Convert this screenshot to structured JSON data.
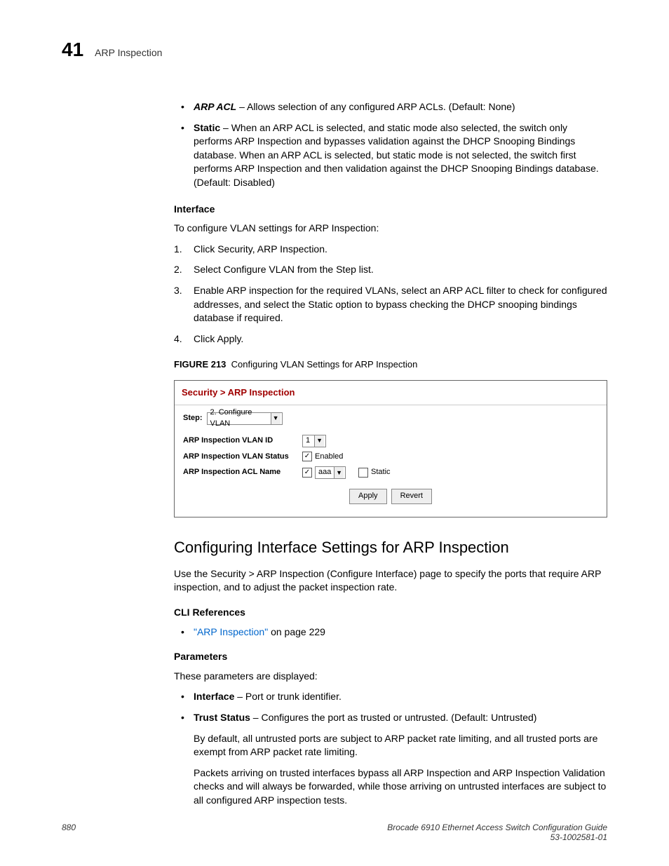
{
  "header": {
    "chapter": "41",
    "title": "ARP Inspection"
  },
  "upper_bullets": {
    "arp_acl_label": "ARP ACL",
    "arp_acl_text": " – Allows selection of any configured ARP ACLs. (Default: None)",
    "static_label": "Static",
    "static_text": " – When an ARP ACL is selected, and static mode also selected, the switch only performs ARP Inspection and bypasses validation against the DHCP Snooping Bindings database. When an ARP ACL is selected, but static mode is not selected, the switch first performs ARP Inspection and then validation against the DHCP Snooping Bindings database. (Default: Disabled)"
  },
  "interface_section": {
    "heading": "Interface",
    "intro": "To configure VLAN settings for ARP Inspection:",
    "steps": [
      "Click Security, ARP Inspection.",
      "Select Configure VLAN from the Step list.",
      "Enable ARP inspection for the required VLANs, select an ARP ACL filter to check for configured addresses, and select the Static option to bypass checking the DHCP snooping bindings database if required.",
      "Click Apply."
    ]
  },
  "figure": {
    "label": "FIGURE 213",
    "caption": "Configuring VLAN Settings for ARP Inspection",
    "breadcrumb": "Security > ARP Inspection",
    "step_label": "Step:",
    "step_value": "2. Configure VLAN",
    "vlan_id_label": "ARP Inspection VLAN ID",
    "vlan_id_value": "1",
    "vlan_status_label": "ARP Inspection VLAN Status",
    "vlan_status_checked": true,
    "vlan_status_text": "Enabled",
    "acl_name_label": "ARP Inspection ACL Name",
    "acl_name_checked": true,
    "acl_name_value": "aaa",
    "static_checked": false,
    "static_text": "Static",
    "apply": "Apply",
    "revert": "Revert"
  },
  "h2": "Configuring Interface Settings for ARP Inspection",
  "intro2": "Use the Security > ARP Inspection (Configure Interface) page to specify the ports that require ARP inspection, and to adjust the packet inspection rate.",
  "cli": {
    "heading": "CLI References",
    "link": "\"ARP Inspection\"",
    "tail": " on page 229"
  },
  "params": {
    "heading": "Parameters",
    "intro": "These parameters are displayed:",
    "iface_label": "Interface",
    "iface_text": " – Port or trunk identifier.",
    "trust_label": "Trust Status",
    "trust_text": " – Configures the port as trusted or untrusted. (Default: Untrusted)",
    "trust_para1": "By default, all untrusted ports are subject to ARP packet rate limiting, and all trusted ports are exempt from ARP packet rate limiting.",
    "trust_para2": "Packets arriving on trusted interfaces bypass all ARP Inspection and ARP Inspection Validation checks and will always be forwarded, while those arriving on untrusted interfaces are subject to all configured ARP inspection tests."
  },
  "footer": {
    "page": "880",
    "guide": "Brocade 6910 Ethernet Access Switch Configuration Guide",
    "docnum": "53-1002581-01"
  }
}
